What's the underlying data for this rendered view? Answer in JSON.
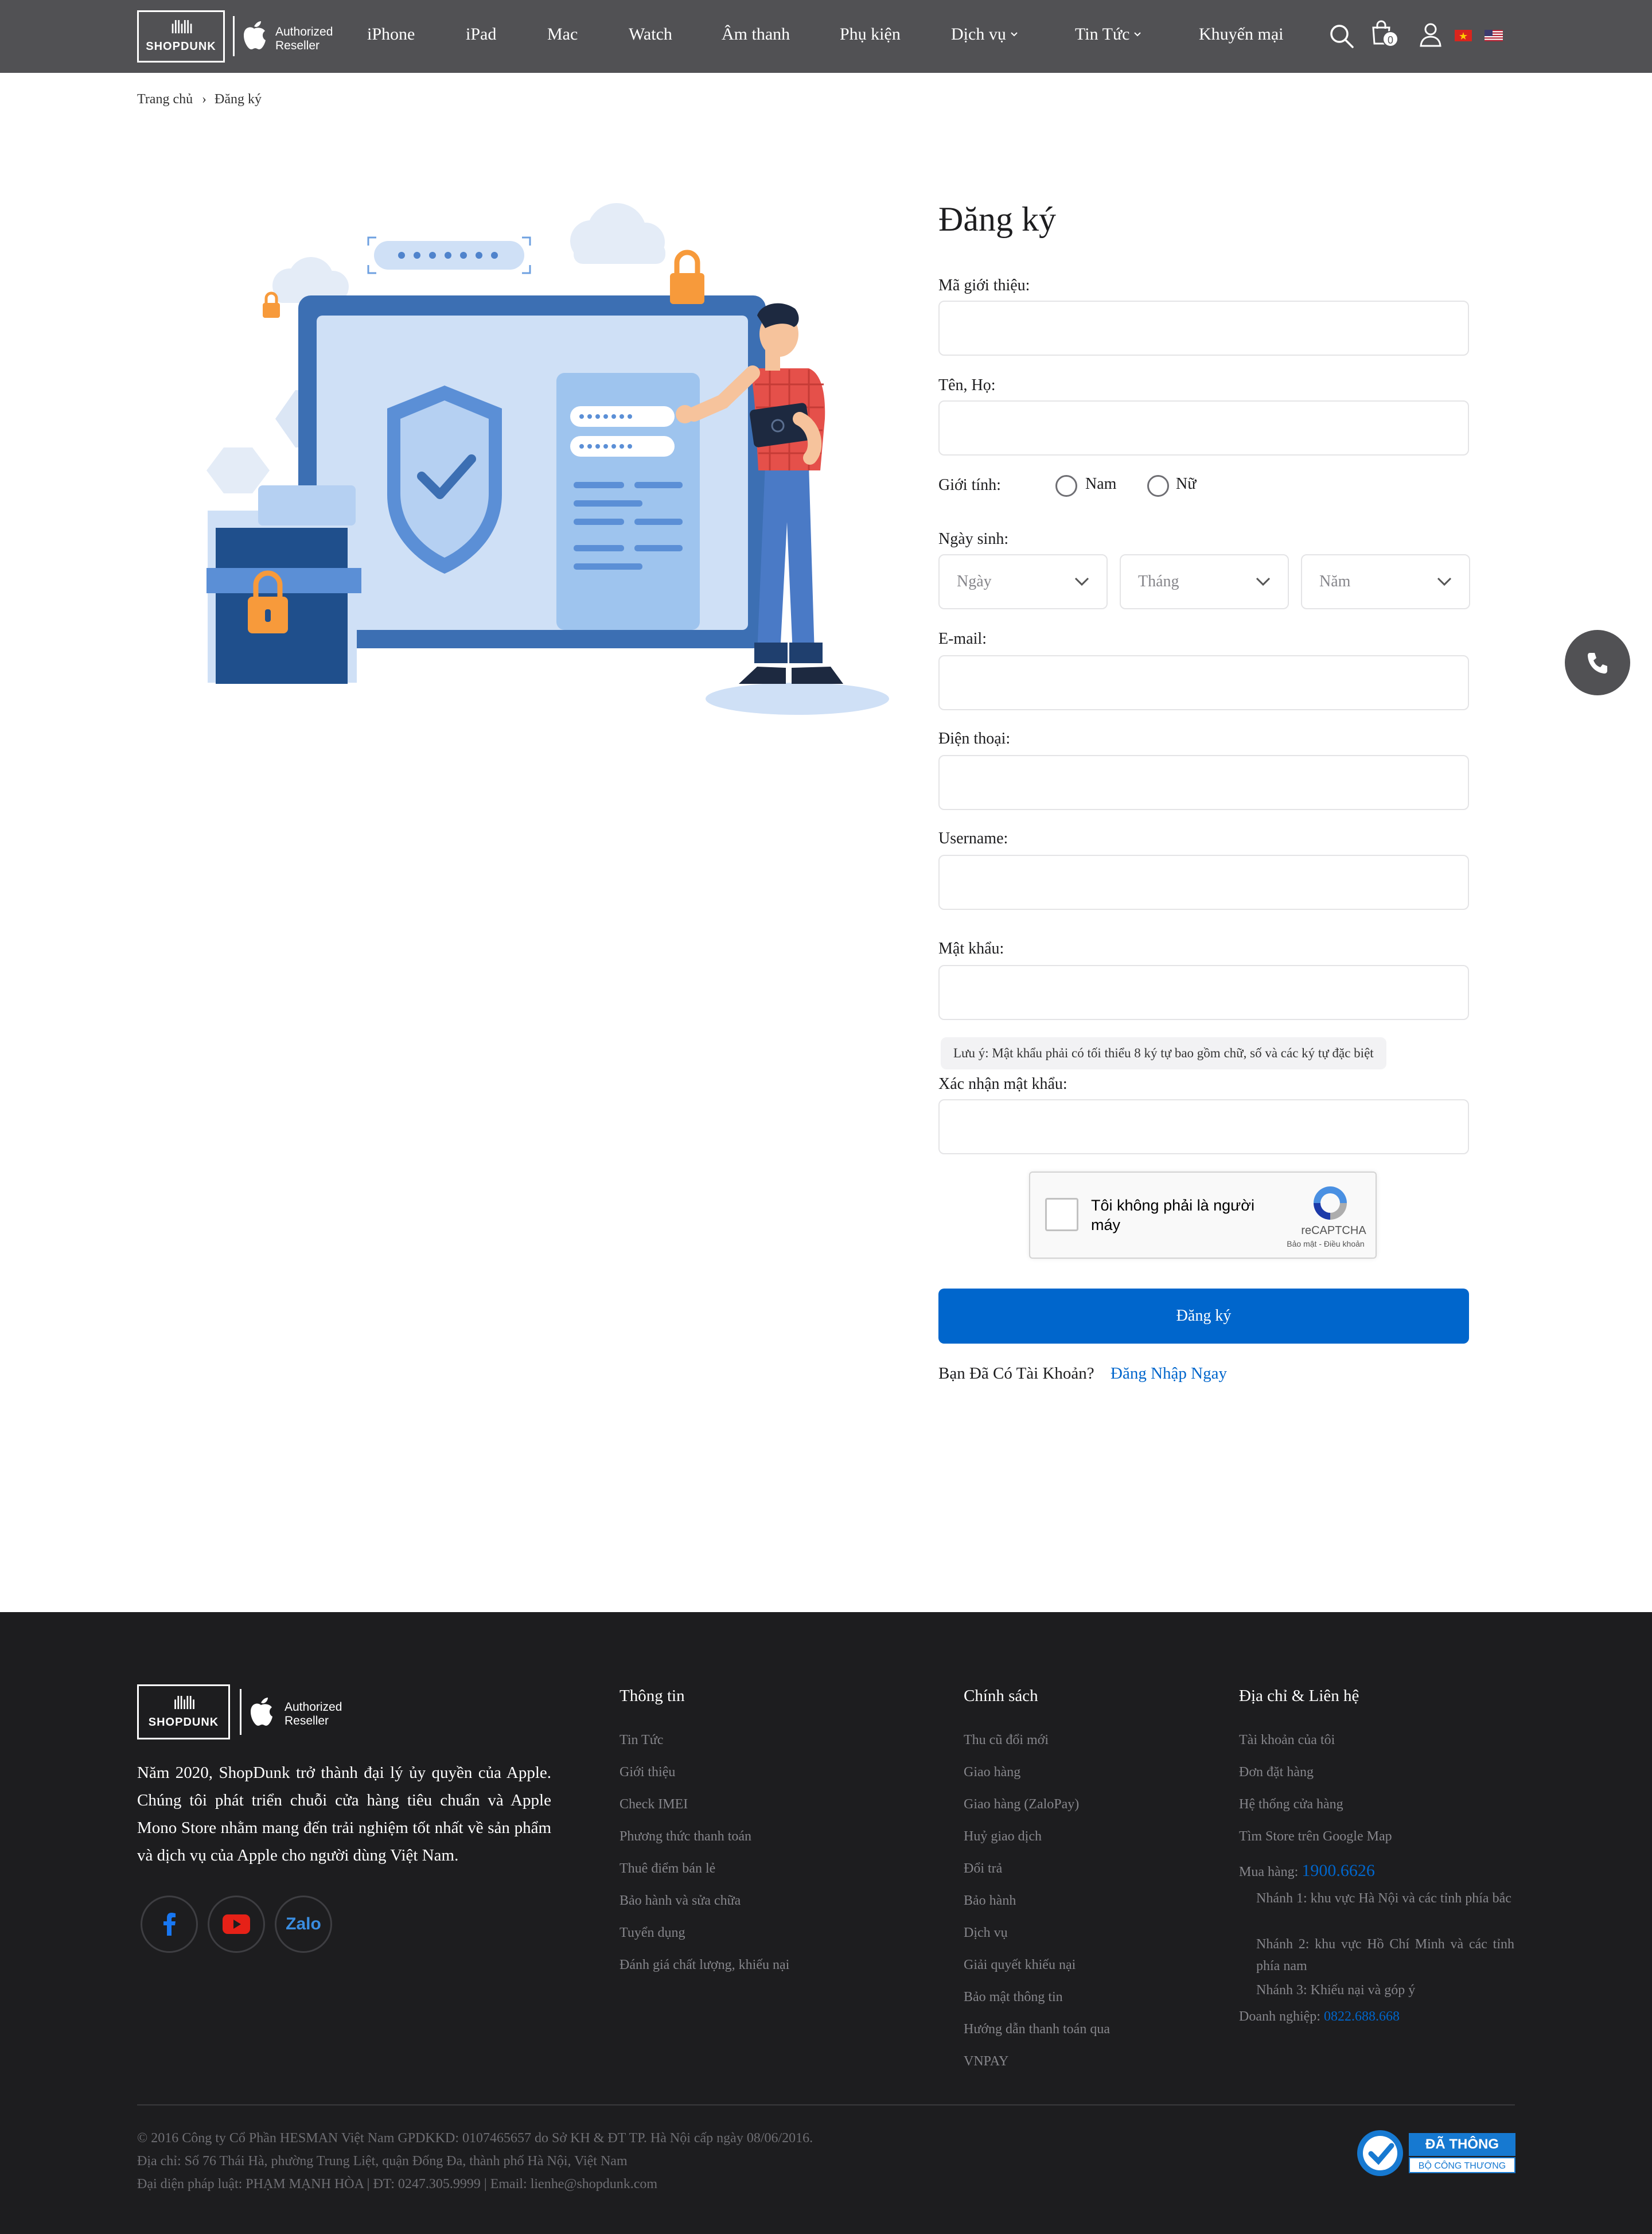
{
  "header": {
    "logo_text": "SHOPDUNK",
    "authorized": "Authorized",
    "reseller": "Reseller",
    "nav": [
      "iPhone",
      "iPad",
      "Mac",
      "Watch",
      "Âm thanh",
      "Phụ kiện",
      "Dịch vụ",
      "Tin Tức",
      "Khuyến mại"
    ],
    "cart_count": "0",
    "icons": [
      "search-icon",
      "cart-icon",
      "user-icon",
      "vietnam-flag-icon",
      "usa-flag-icon"
    ]
  },
  "breadcrumb": {
    "home": "Trang chủ",
    "separator": "›",
    "current": "Đăng ký"
  },
  "form": {
    "title": "Đăng ký",
    "referral_label": "Mã giới thiệu:",
    "name_label": "Tên, Họ:",
    "gender_label": "Giới tính:",
    "gender_male": "Nam",
    "gender_female": "Nữ",
    "dob_label": "Ngày sinh:",
    "day_placeholder": "Ngày",
    "month_placeholder": "Tháng",
    "year_placeholder": "Năm",
    "email_label": "E-mail:",
    "phone_label": "Điện thoại:",
    "username_label": "Username:",
    "password_label": "Mật khẩu:",
    "password_note": "Lưu ý: Mật khẩu phải có tối thiểu 8 ký tự bao gồm chữ, số và các ký tự đặc biệt",
    "confirm_label": "Xác nhận mật khẩu:",
    "captcha_text": "Tôi không phải là người máy",
    "captcha_brand": "reCAPTCHA",
    "captcha_terms": "Bảo mật - Điều khoản",
    "submit": "Đăng ký",
    "have_account": "Bạn Đã Có Tài Khoản?",
    "login_link": "Đăng Nhập Ngay"
  },
  "footer": {
    "logo_text": "SHOPDUNK",
    "authorized": "Authorized",
    "reseller": "Reseller",
    "description": "Năm 2020, ShopDunk trở thành đại lý ủy quyền của Apple. Chúng tôi phát triển chuỗi cửa hàng tiêu chuẩn và Apple Mono Store nhằm mang đến trải nghiệm tốt nhất về sản phẩm và dịch vụ của Apple cho người dùng Việt Nam.",
    "social": [
      "facebook-icon",
      "youtube-icon",
      "zalo-icon"
    ],
    "zalo_label": "Zalo",
    "info": {
      "title": "Thông tin",
      "links": [
        "Tin Tức",
        "Giới thiệu",
        "Check IMEI",
        "Phương thức thanh toán",
        "Thuê điểm bán lẻ",
        "Bảo hành và sửa chữa",
        "Tuyển dụng",
        "Đánh giá chất lượng, khiếu nại"
      ]
    },
    "policy": {
      "title": "Chính sách",
      "links": [
        "Thu cũ đổi mới",
        "Giao hàng",
        "Giao hàng (ZaloPay)",
        "Huỷ giao dịch",
        "Đổi trả",
        "Bảo hành",
        "Dịch vụ",
        "Giải quyết khiếu nại",
        "Bảo mật thông tin",
        "Hướng dẫn thanh toán qua",
        "VNPAY"
      ]
    },
    "contact": {
      "title": "Địa chỉ & Liên hệ",
      "links": [
        "Tài khoản của tôi",
        "Đơn đặt hàng",
        "Hệ thống cửa hàng",
        "Tìm Store trên Google Map"
      ],
      "buy_label": "Mua hàng:",
      "buy_phone": "1900.6626",
      "branch1": "Nhánh 1: khu vực Hà Nội và các tỉnh phía bắc",
      "branch2": "Nhánh 2: khu vực Hồ Chí Minh và các tỉnh phía nam",
      "branch3": "Nhánh 3: Khiếu nại và góp ý",
      "biz_label": "Doanh nghiệp:",
      "biz_phone": "0822.688.668"
    },
    "copyright": [
      "© 2016 Công ty Cổ Phần HESMAN Việt Nam GPDKKD: 0107465657 do Sở KH & ĐT TP. Hà Nội cấp ngày 08/06/2016.",
      "Địa chỉ: Số 76 Thái Hà, phường Trung Liệt, quận Đống Đa, thành phố Hà Nội, Việt Nam",
      "Đại diện pháp luật: PHẠM MẠNH HÒA | ĐT: 0247.305.9999 | Email: lienhe@shopdunk.com"
    ],
    "badge_line1": "ĐÃ THÔNG BÁO",
    "badge_line2": "BỘ CÔNG THƯƠNG"
  },
  "colors": {
    "header_bg": "#515154",
    "footer_bg": "#1d1d1f",
    "accent": "#0066cc",
    "input_border": "#e4e4e6"
  }
}
